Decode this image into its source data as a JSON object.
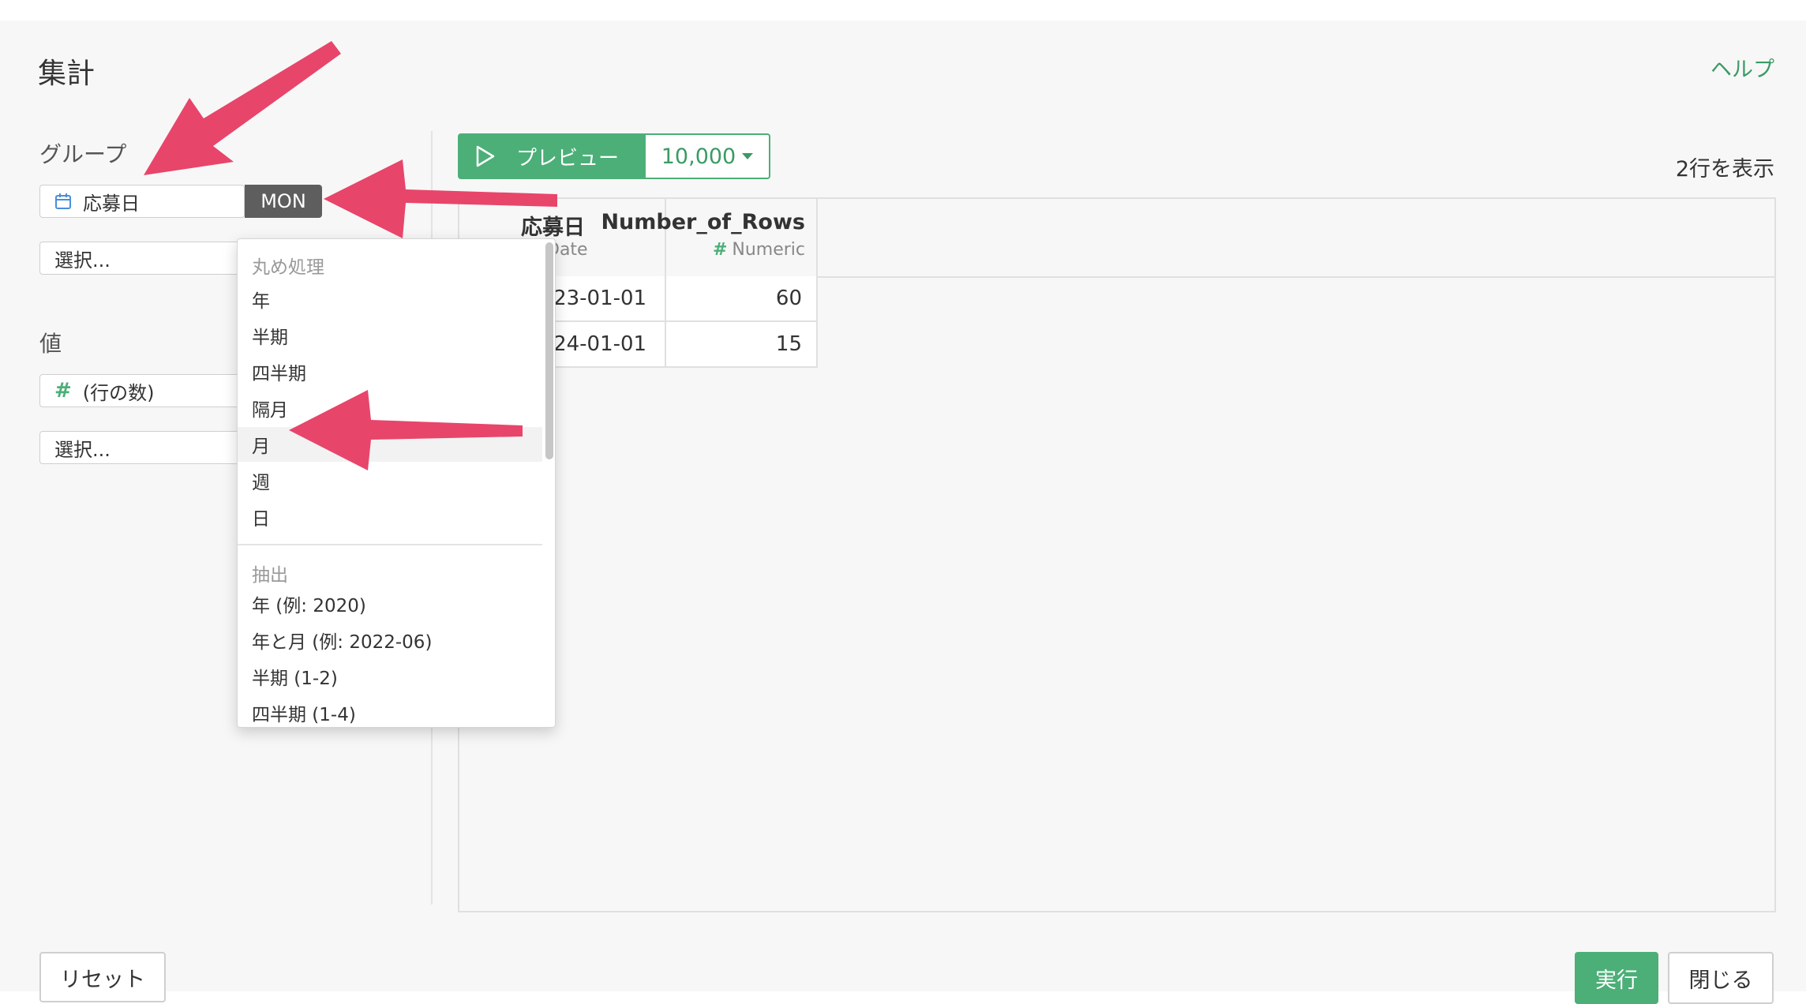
{
  "dialog": {
    "title": "集計",
    "help_label": "ヘルプ"
  },
  "group_section": {
    "label": "グループ",
    "field_value": "応募日",
    "field_icon": "calendar-icon",
    "rounding_button": "MON",
    "select_placeholder": "選択..."
  },
  "value_section": {
    "label": "値",
    "field_value": "(行の数)",
    "field_icon": "hash-icon",
    "select_placeholder": "選択..."
  },
  "preview": {
    "button_label": "プレビュー",
    "rows_option": "10,000",
    "row_count_text": "2行を表示"
  },
  "table": {
    "columns": [
      {
        "name": "応募日",
        "type": "Date",
        "type_icon": "calendar-icon"
      },
      {
        "name": "Number_of_Rows",
        "type": "Numeric",
        "type_icon": "hash-icon"
      }
    ],
    "rows": [
      [
        "2023-01-01",
        "60"
      ],
      [
        "2024-01-01",
        "15"
      ]
    ]
  },
  "dropdown": {
    "rounding_header": "丸め処理",
    "rounding_items": [
      "年",
      "半期",
      "四半期",
      "隔月",
      "月",
      "週",
      "日"
    ],
    "selected_item": "月",
    "extract_header": "抽出",
    "extract_items": [
      "年 (例: 2020)",
      "年と月 (例: 2022-06)",
      "半期 (1-2)",
      "四半期 (1-4)"
    ]
  },
  "footer": {
    "reset_label": "リセット",
    "run_label": "実行",
    "close_label": "閉じる"
  },
  "colors": {
    "accent": "#4caf78",
    "annotation_arrow": "#e8456b"
  }
}
